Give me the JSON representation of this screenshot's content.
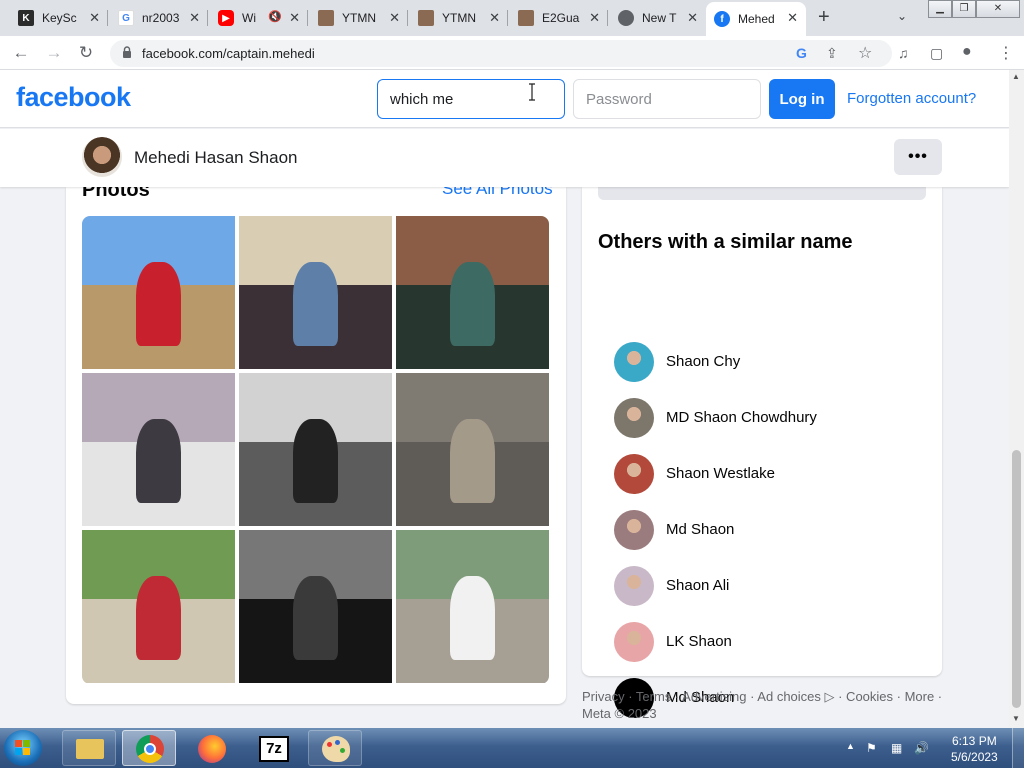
{
  "browser": {
    "tabs": [
      {
        "label": "KeySc",
        "favicon": "keyscore-icon",
        "color": "#2b2b2b",
        "active": false
      },
      {
        "label": "nr2003",
        "favicon": "google-icon",
        "color": "#4285f4",
        "active": false
      },
      {
        "label": "Wi",
        "favicon": "youtube-icon",
        "color": "#ff0000",
        "active": false
      },
      {
        "label": "YTMN",
        "favicon": "ytmn-icon",
        "color": "#8a6a52",
        "active": false
      },
      {
        "label": "YTMN",
        "favicon": "ytmn-icon",
        "color": "#8a6a52",
        "active": false
      },
      {
        "label": "E2Gua",
        "favicon": "e2guardian-icon",
        "color": "#8a6a52",
        "active": false
      },
      {
        "label": "New T",
        "favicon": "chrome-icon",
        "color": "#5f6368",
        "active": false
      },
      {
        "label": "Mehed",
        "favicon": "facebook-icon",
        "color": "#1877f2",
        "active": true
      }
    ],
    "close_glyph": "✕",
    "new_tab_glyph": "+",
    "tab_search_glyph": "⌄",
    "window_controls": [
      "▁",
      "❐",
      "✕"
    ],
    "url": "facebook.com/captain.mehedi",
    "nav": {
      "back": "←",
      "forward": "→",
      "reload": "↻"
    },
    "omni_icons": {
      "google": "G",
      "share": "⇪",
      "star": "☆"
    },
    "toolbar_icons": {
      "media": "♫",
      "sidepanel": "▢",
      "profile": "●",
      "menu": "⋮"
    }
  },
  "facebook": {
    "logo": "facebook",
    "login": {
      "email_value": "which me",
      "password_placeholder": "Password",
      "login_label": "Log in",
      "forgot_label": "Forgotten account?"
    },
    "profile": {
      "name": "Mehedi Hasan Shaon",
      "more_label": "•••"
    },
    "photos": {
      "title": "Photos",
      "see_all": "See All Photos",
      "items": [
        {
          "name": "photo-motorbike-road",
          "sky": "#6ea8e6",
          "ground": "#b89a6a",
          "accent": "#c8202c"
        },
        {
          "name": "photo-group-selfie",
          "sky": "#d9cdb4",
          "ground": "#3a3036",
          "accent": "#5d7fa8"
        },
        {
          "name": "photo-two-friends",
          "sky": "#8b5d46",
          "ground": "#27372f",
          "accent": "#3d6a63"
        },
        {
          "name": "photo-friends-market",
          "sky": "#b5a9b8",
          "ground": "#e4e4e4",
          "accent": "#3d3a41"
        },
        {
          "name": "photo-bw-biker",
          "sky": "#d2d2d2",
          "ground": "#5c5c5c",
          "accent": "#222222"
        },
        {
          "name": "photo-monkeys",
          "sky": "#7f7a72",
          "ground": "#5f5b56",
          "accent": "#a49a8a"
        },
        {
          "name": "photo-family-bike",
          "sky": "#6f9b52",
          "ground": "#cfc7b1",
          "accent": "#c02a35"
        },
        {
          "name": "photo-bw-tree",
          "sky": "#777777",
          "ground": "#151515",
          "accent": "#3a3a3a"
        },
        {
          "name": "photo-helmet-rider",
          "sky": "#7e9c7a",
          "ground": "#a69f94",
          "accent": "#f1f1f1"
        }
      ]
    },
    "similar": {
      "title": "Others with a similar name",
      "people": [
        {
          "name": "Shaon Chy",
          "color": "#3aa8c7"
        },
        {
          "name": "MD Shaon Chowdhury",
          "color": "#7d766b"
        },
        {
          "name": "Shaon Westlake",
          "color": "#b2493a"
        },
        {
          "name": "Md Shaon",
          "color": "#9b7c7e"
        },
        {
          "name": "Shaon Ali",
          "color": "#c9b9c8"
        },
        {
          "name": "LK Shaon",
          "color": "#e8a5a7"
        },
        {
          "name": "Md Shaon",
          "color": "#000000"
        }
      ]
    },
    "footer": {
      "line1": "Privacy · Terms · Advertising · Ad choices ▷ · Cookies · More ·",
      "line2": "Meta © 2023"
    }
  },
  "taskbar": {
    "apps": [
      {
        "name": "explorer-icon",
        "active": false
      },
      {
        "name": "chrome-icon",
        "active": true
      },
      {
        "name": "firefox-icon",
        "active": false
      },
      {
        "name": "7zip-icon",
        "active": false
      },
      {
        "name": "paint-icon",
        "active": false
      }
    ],
    "sevenzip_label": "7z",
    "clock_time": "6:13 PM",
    "clock_date": "5/6/2023"
  }
}
